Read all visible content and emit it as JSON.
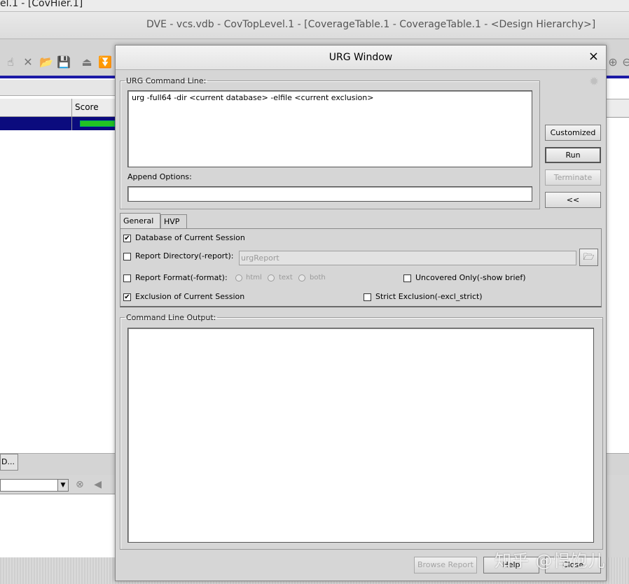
{
  "background": {
    "top_strip_text": "el.1 - [CovHier.1]",
    "main_title": "DVE - vcs.vdb -  CovTopLevel.1 - [CoverageTable.1 - CoverageTable.1 - <Design Hierarchy>]",
    "table_header_score": "Score",
    "d_button_label": "D...",
    "selected_row_bar_color": "#22c322",
    "selection_color": "#0b0b7e"
  },
  "dialog": {
    "title": "URG Window",
    "close_glyph": "×",
    "command_group_label": "URG Command Line:",
    "command_text": "urg -full64 -dir <current database> -elfile <current exclusion>",
    "append_label": "Append Options:",
    "append_value": "",
    "buttons": {
      "customized": "Customized",
      "run": "Run",
      "terminate": "Terminate",
      "collapse": "<<",
      "browse_report": "Browse Report",
      "help": "Help",
      "close": "Close"
    },
    "tabs": [
      {
        "label": "General",
        "active": true
      },
      {
        "label": "HVP",
        "active": false
      }
    ],
    "options": {
      "database_current_session": {
        "label": "Database of Current Session",
        "checked": true
      },
      "report_directory": {
        "label": "Report Directory(-report):",
        "checked": false,
        "value": "urgReport"
      },
      "report_format": {
        "label": "Report Format(-format):",
        "checked": false,
        "choices": [
          "html",
          "text",
          "both"
        ]
      },
      "uncovered_only": {
        "label": "Uncovered Only(-show brief)",
        "checked": false
      },
      "exclusion_current_session": {
        "label": "Exclusion of Current Session",
        "checked": true
      },
      "strict_exclusion": {
        "label": "Strict Exclusion(-excl_strict)",
        "checked": false
      }
    },
    "output_group_label": "Command Line Output:",
    "output_text": ""
  },
  "watermark": "知乎 @悍饱儿"
}
